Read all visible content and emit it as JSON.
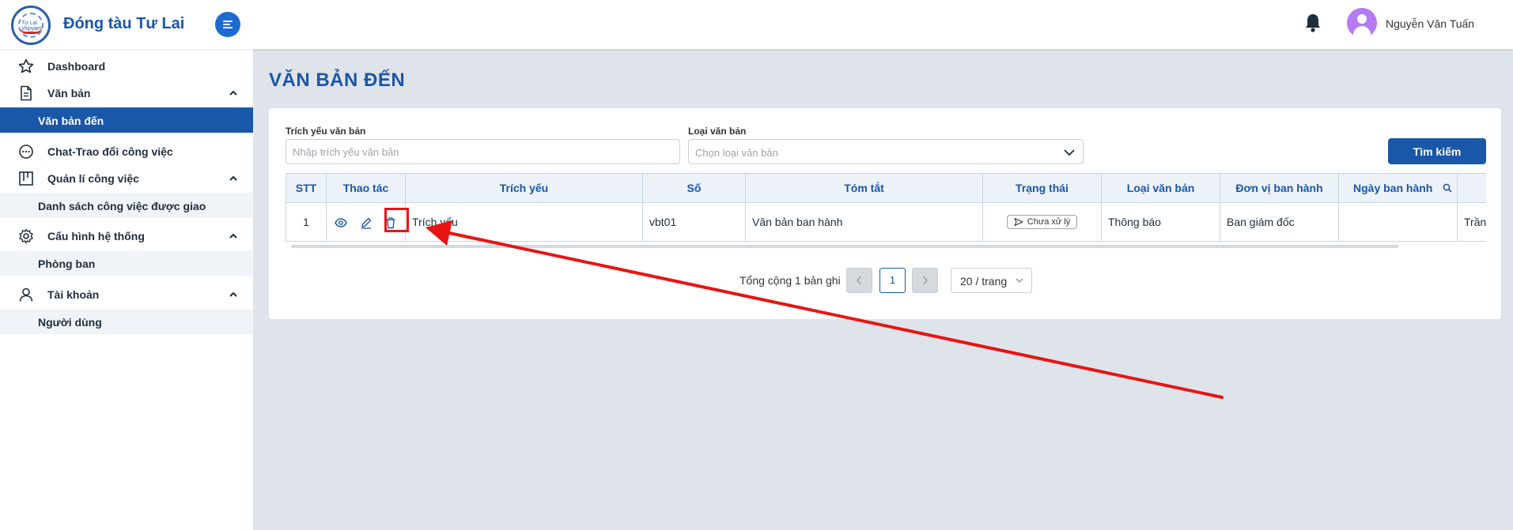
{
  "app": {
    "brand": "Đóng tàu Tư Lai",
    "logo_text": "Tư Lai shipyard"
  },
  "header": {
    "username": "Nguyễn Văn Tuấn"
  },
  "sidebar": {
    "items": [
      {
        "label": "Dashboard"
      },
      {
        "label": "Văn bản",
        "sub": "Văn bản đến"
      },
      {
        "label": "Chat-Trao đổi công việc"
      },
      {
        "label": "Quản lí công việc",
        "sub": "Danh sách công việc được giao"
      },
      {
        "label": "Cấu hình hệ thống",
        "sub": "Phòng ban"
      },
      {
        "label": "Tài khoản",
        "sub": "Người dùng"
      }
    ]
  },
  "page": {
    "title": "VĂN BẢN ĐẾN"
  },
  "filters": {
    "summary_label": "Trích yếu văn bản",
    "summary_placeholder": "Nhập trích yếu văn bản",
    "type_label": "Loại văn bản",
    "type_placeholder": "Chọn loại văn bản",
    "search_button": "Tìm kiếm"
  },
  "table": {
    "columns": [
      "STT",
      "Thao tác",
      "Trích yếu",
      "Số",
      "Tóm tắt",
      "Trạng thái",
      "Loại văn bản",
      "Đơn vị ban hành",
      "Ngày ban hành",
      ""
    ],
    "rows": [
      {
        "stt": "1",
        "summary": "Trích yếu",
        "number": "vbt01",
        "abstract": "Văn bản ban hành",
        "status": "Chưa xử lý",
        "type": "Thông báo",
        "issuer": "Ban giám đốc",
        "date": "",
        "extra": "Trần"
      }
    ]
  },
  "pagination": {
    "total": "Tổng cộng 1 bản ghi",
    "current": "1",
    "page_size": "20 / trang"
  },
  "colors": {
    "primary": "#1a57a8",
    "annotation": "#e81414"
  }
}
